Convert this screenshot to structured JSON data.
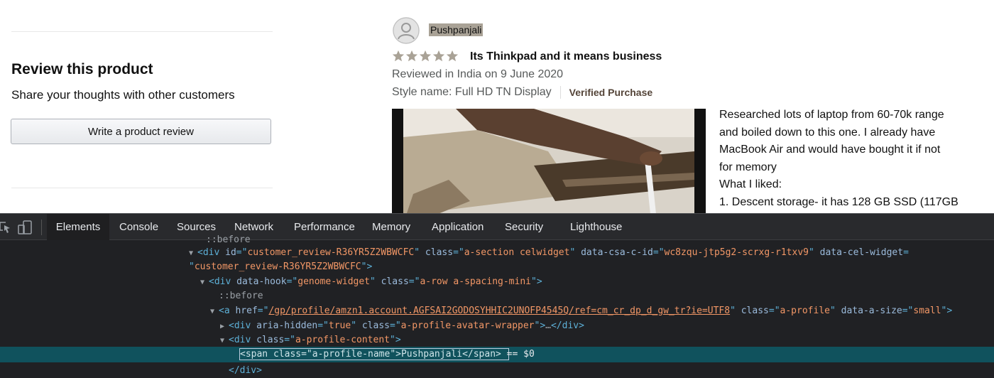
{
  "page": {
    "review_this_product": {
      "title": "Review this product",
      "subtitle": "Share your thoughts with other customers",
      "button_label": "Write a product review"
    },
    "review": {
      "reviewer_name": "Pushpanjali",
      "rating": 5,
      "headline": "Its Thinkpad and it means business",
      "reviewed_in": "Reviewed in India on 9 June 2020",
      "style_name": "Style name: Full HD TN Display",
      "verified": "Verified Purchase",
      "body_lines": [
        " Researched lots of laptop from 60-70k range",
        "and boiled down to this one. I already have",
        "MacBook Air and would have bought it if not",
        "for memory",
        "What I liked:",
        "1. Descent storage- it has 128 GB SSD (117GB"
      ]
    }
  },
  "devtools": {
    "tabs": [
      "Elements",
      "Console",
      "Sources",
      "Network",
      "Performance",
      "Memory",
      "Application",
      "Security",
      "Lighthouse"
    ],
    "active_tab": "Elements",
    "dom": {
      "line0": "::before",
      "review_id": "customer_review-R36YR5Z2WBWCFC",
      "section_class": "a-section celwidget",
      "csa_id": "wc8zqu-jtp5g2-scrxg-r1txv9",
      "genome_hook": "genome-widget",
      "row_class": "a-row a-spacing-mini",
      "before": "::before",
      "href": "/gp/profile/amzn1.account.AGFSAI2GODOSYHHIC2UNOFP4545Q/ref=cm_cr_dp_d_gw_tr?ie=UTF8",
      "profile_class": "a-profile",
      "size": "small",
      "aria_hidden": "true",
      "avatar_class": "a-profile-avatar-wrapper",
      "ellipsis": "…",
      "content_class": "a-profile-content",
      "selected_html": "<span class=\"a-profile-name\">Pushpanjali</span>",
      "selected_suffix": " == $0",
      "closing_div": "</div>"
    }
  }
}
